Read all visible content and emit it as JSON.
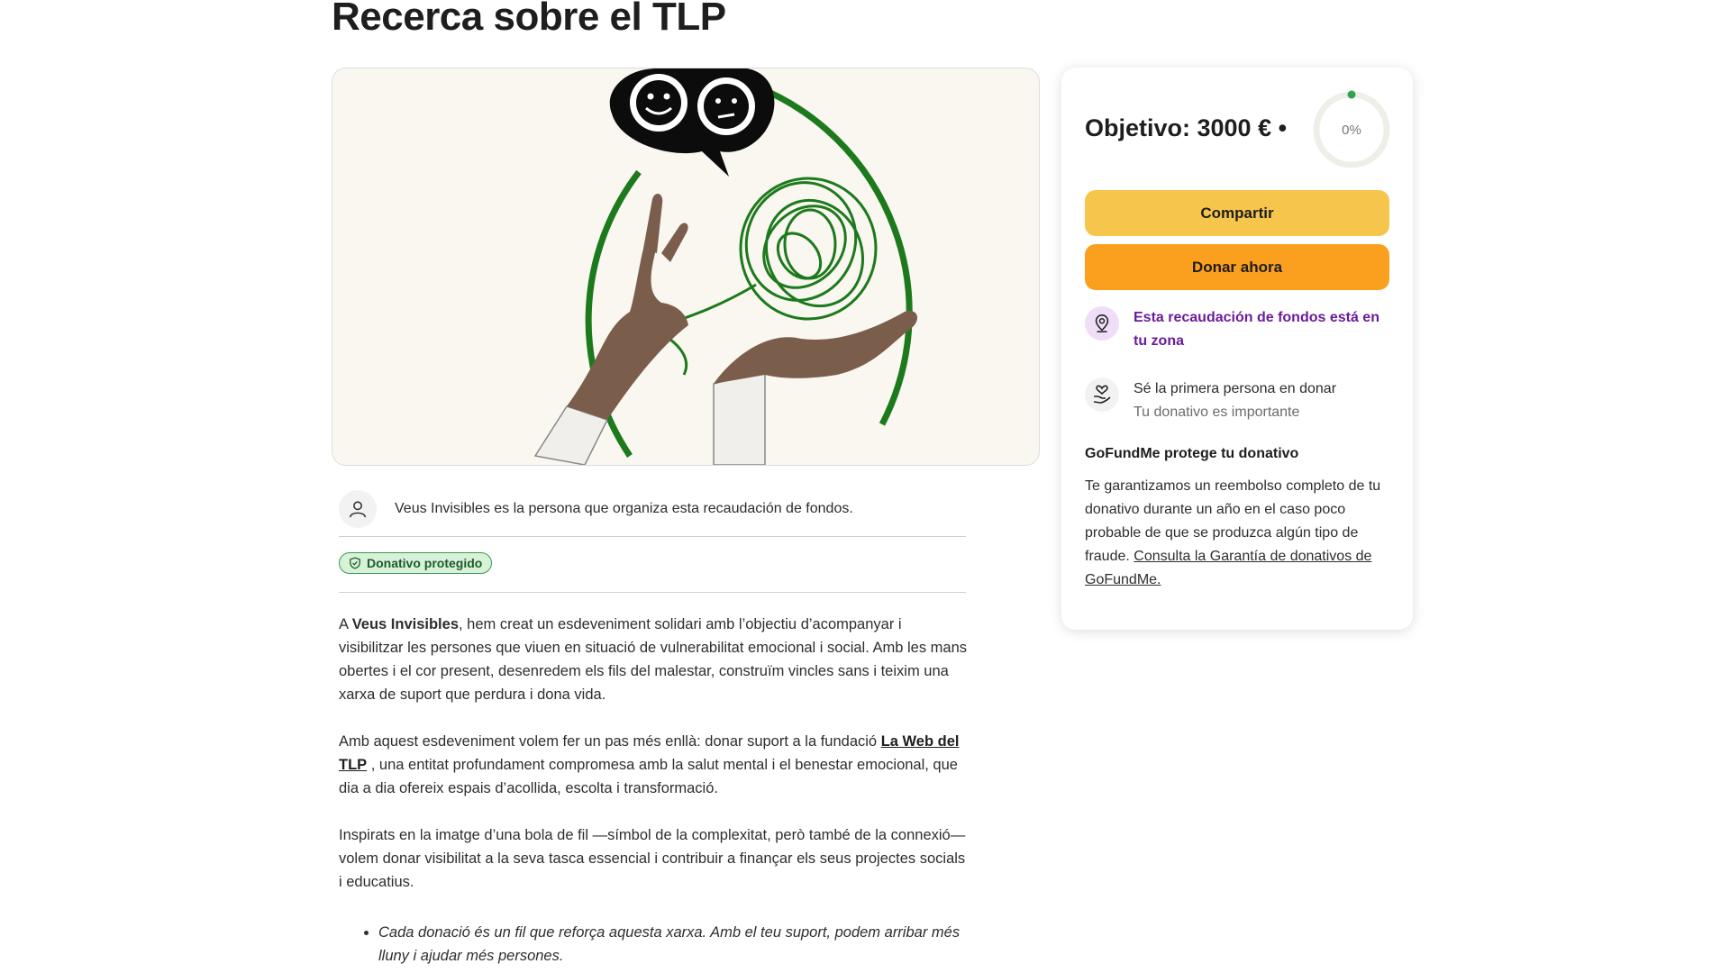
{
  "page": {
    "title": "Recerca sobre el TLP"
  },
  "organizer": {
    "text": "Veus Invisibles es la persona que organiza esta recaudación de fondos."
  },
  "badge": {
    "label": "Donativo protegido"
  },
  "story": {
    "p1_prefix": "A ",
    "p1_bold": "Veus Invisibles",
    "p1_rest": ", hem creat un esdeveniment solidari amb l’objectiu d’acompanyar i visibilitzar les persones que viuen en situació de vulnerabilitat emocional i social. Amb les mans obertes i el cor present, desenredem els fils del malestar, construïm vincles sans i teixim una xarxa de suport que perdura i dona vida.",
    "p2_prefix": "Amb aquest esdeveniment volem fer un pas més enllà: donar suport a la fundació ",
    "p2_link": "La Web del TLP",
    "p2_rest": " , una entitat profundament compromesa amb la salut mental i el benestar emocional, que dia a dia ofereix espais d’acollida, escolta i transformació.",
    "p3": "Inspirats en la imatge d’una bola de fil —símbol de la complexitat, però també de la connexió— volem donar visibilitat a la seva tasca essencial i contribuir a finançar els seus projectes socials i educatius.",
    "bullet1": "Cada donació és un fil que reforça aquesta xarxa. Amb el teu suport, podem arribar més lluny i ajudar més persones."
  },
  "sidebar": {
    "goal": "Objetivo: 3000 € •",
    "progress_label": "0%",
    "progress_fraction": 0,
    "share_label": "Compartir",
    "donate_label": "Donar ahora",
    "zone_text": "Esta recaudación de fondos está en tu zona",
    "first_title": "Sé la primera persona en donar",
    "first_sub": "Tu donativo es importante",
    "protect_title": "GoFundMe protege tu donativo",
    "protect_text": "Te garantizamos un reembolso completo de tu donativo durante un año en el caso poco probable de que se produzca algún tipo de fraude. ",
    "protect_link": "Consulta la Garantía de donativos de GoFundMe."
  },
  "colors": {
    "share_button": "#f6c64c",
    "donate_button": "#fba01e",
    "zone_accent": "#6b1b9a",
    "badge_bg": "#d7f2d9",
    "progress_dot": "#2ea44f"
  }
}
